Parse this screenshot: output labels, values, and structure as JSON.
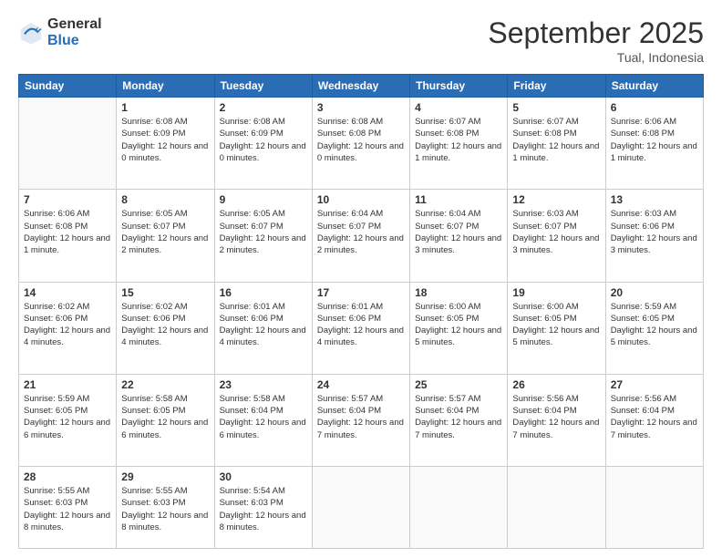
{
  "logo": {
    "general": "General",
    "blue": "Blue"
  },
  "header": {
    "month": "September 2025",
    "location": "Tual, Indonesia"
  },
  "weekdays": [
    "Sunday",
    "Monday",
    "Tuesday",
    "Wednesday",
    "Thursday",
    "Friday",
    "Saturday"
  ],
  "weeks": [
    [
      {
        "day": "",
        "info": ""
      },
      {
        "day": "1",
        "info": "Sunrise: 6:08 AM\nSunset: 6:09 PM\nDaylight: 12 hours\nand 0 minutes."
      },
      {
        "day": "2",
        "info": "Sunrise: 6:08 AM\nSunset: 6:09 PM\nDaylight: 12 hours\nand 0 minutes."
      },
      {
        "day": "3",
        "info": "Sunrise: 6:08 AM\nSunset: 6:08 PM\nDaylight: 12 hours\nand 0 minutes."
      },
      {
        "day": "4",
        "info": "Sunrise: 6:07 AM\nSunset: 6:08 PM\nDaylight: 12 hours\nand 1 minute."
      },
      {
        "day": "5",
        "info": "Sunrise: 6:07 AM\nSunset: 6:08 PM\nDaylight: 12 hours\nand 1 minute."
      },
      {
        "day": "6",
        "info": "Sunrise: 6:06 AM\nSunset: 6:08 PM\nDaylight: 12 hours\nand 1 minute."
      }
    ],
    [
      {
        "day": "7",
        "info": "Sunrise: 6:06 AM\nSunset: 6:08 PM\nDaylight: 12 hours\nand 1 minute."
      },
      {
        "day": "8",
        "info": "Sunrise: 6:05 AM\nSunset: 6:07 PM\nDaylight: 12 hours\nand 2 minutes."
      },
      {
        "day": "9",
        "info": "Sunrise: 6:05 AM\nSunset: 6:07 PM\nDaylight: 12 hours\nand 2 minutes."
      },
      {
        "day": "10",
        "info": "Sunrise: 6:04 AM\nSunset: 6:07 PM\nDaylight: 12 hours\nand 2 minutes."
      },
      {
        "day": "11",
        "info": "Sunrise: 6:04 AM\nSunset: 6:07 PM\nDaylight: 12 hours\nand 3 minutes."
      },
      {
        "day": "12",
        "info": "Sunrise: 6:03 AM\nSunset: 6:07 PM\nDaylight: 12 hours\nand 3 minutes."
      },
      {
        "day": "13",
        "info": "Sunrise: 6:03 AM\nSunset: 6:06 PM\nDaylight: 12 hours\nand 3 minutes."
      }
    ],
    [
      {
        "day": "14",
        "info": "Sunrise: 6:02 AM\nSunset: 6:06 PM\nDaylight: 12 hours\nand 4 minutes."
      },
      {
        "day": "15",
        "info": "Sunrise: 6:02 AM\nSunset: 6:06 PM\nDaylight: 12 hours\nand 4 minutes."
      },
      {
        "day": "16",
        "info": "Sunrise: 6:01 AM\nSunset: 6:06 PM\nDaylight: 12 hours\nand 4 minutes."
      },
      {
        "day": "17",
        "info": "Sunrise: 6:01 AM\nSunset: 6:06 PM\nDaylight: 12 hours\nand 4 minutes."
      },
      {
        "day": "18",
        "info": "Sunrise: 6:00 AM\nSunset: 6:05 PM\nDaylight: 12 hours\nand 5 minutes."
      },
      {
        "day": "19",
        "info": "Sunrise: 6:00 AM\nSunset: 6:05 PM\nDaylight: 12 hours\nand 5 minutes."
      },
      {
        "day": "20",
        "info": "Sunrise: 5:59 AM\nSunset: 6:05 PM\nDaylight: 12 hours\nand 5 minutes."
      }
    ],
    [
      {
        "day": "21",
        "info": "Sunrise: 5:59 AM\nSunset: 6:05 PM\nDaylight: 12 hours\nand 6 minutes."
      },
      {
        "day": "22",
        "info": "Sunrise: 5:58 AM\nSunset: 6:05 PM\nDaylight: 12 hours\nand 6 minutes."
      },
      {
        "day": "23",
        "info": "Sunrise: 5:58 AM\nSunset: 6:04 PM\nDaylight: 12 hours\nand 6 minutes."
      },
      {
        "day": "24",
        "info": "Sunrise: 5:57 AM\nSunset: 6:04 PM\nDaylight: 12 hours\nand 7 minutes."
      },
      {
        "day": "25",
        "info": "Sunrise: 5:57 AM\nSunset: 6:04 PM\nDaylight: 12 hours\nand 7 minutes."
      },
      {
        "day": "26",
        "info": "Sunrise: 5:56 AM\nSunset: 6:04 PM\nDaylight: 12 hours\nand 7 minutes."
      },
      {
        "day": "27",
        "info": "Sunrise: 5:56 AM\nSunset: 6:04 PM\nDaylight: 12 hours\nand 7 minutes."
      }
    ],
    [
      {
        "day": "28",
        "info": "Sunrise: 5:55 AM\nSunset: 6:03 PM\nDaylight: 12 hours\nand 8 minutes."
      },
      {
        "day": "29",
        "info": "Sunrise: 5:55 AM\nSunset: 6:03 PM\nDaylight: 12 hours\nand 8 minutes."
      },
      {
        "day": "30",
        "info": "Sunrise: 5:54 AM\nSunset: 6:03 PM\nDaylight: 12 hours\nand 8 minutes."
      },
      {
        "day": "",
        "info": ""
      },
      {
        "day": "",
        "info": ""
      },
      {
        "day": "",
        "info": ""
      },
      {
        "day": "",
        "info": ""
      }
    ]
  ]
}
